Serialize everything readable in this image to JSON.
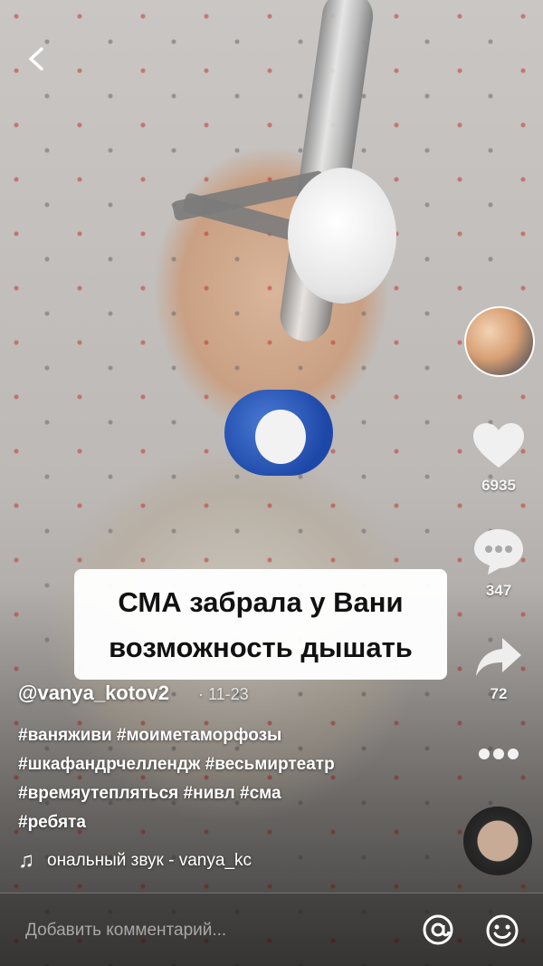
{
  "caption": {
    "line1": "СМА забрала у Вани",
    "line2": "возможность дышать"
  },
  "actions": {
    "likes": "6935",
    "comments": "347",
    "shares": "72"
  },
  "post": {
    "username": "@vanya_kotov2",
    "date": "· 11-23",
    "hashtags": [
      "#ваняживи #моиметаморфозы",
      "#шкафандрчеллендж #весьмиртеатр",
      "#времяутепляться #нивл #сма",
      "#ребята"
    ],
    "sound": "ональный звук - vanya_kc"
  },
  "comment_bar": {
    "placeholder": "Добавить комментарий..."
  },
  "icons": {
    "back": "chevron-left",
    "like": "heart",
    "comment": "speech-bubble",
    "share": "share-arrow",
    "more": "three-dots",
    "music": "music-note",
    "mention": "at-sign",
    "emoji": "smiley"
  }
}
